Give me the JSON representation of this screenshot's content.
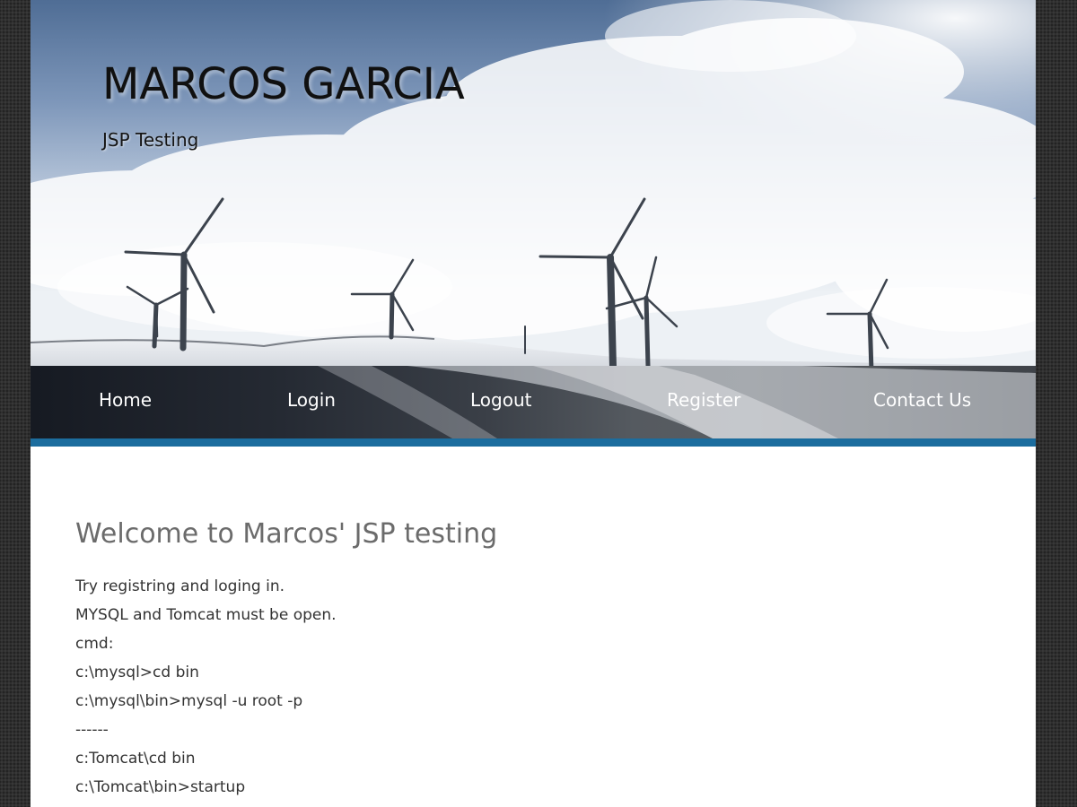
{
  "header": {
    "title": "MARCOS GARCIA",
    "tagline": "JSP Testing",
    "banner_image": "wind-turbines-on-snowy-hill"
  },
  "nav": {
    "items": [
      {
        "label": "Home"
      },
      {
        "label": "Login"
      },
      {
        "label": "Logout"
      },
      {
        "label": "Register"
      },
      {
        "label": "Contact Us"
      }
    ]
  },
  "main": {
    "heading": "Welcome to Marcos' JSP testing",
    "lines": [
      "Try registring and loging in.",
      "MYSQL and Tomcat must be open.",
      "cmd:",
      "c:\\mysql>cd bin",
      "c:\\mysql\\bin>mysql -u root -p",
      "------",
      "c:Tomcat\\cd bin",
      "c:\\Tomcat\\bin>startup"
    ]
  },
  "colors": {
    "accent_bar": "#1c6d9e",
    "page_background": "#2f2f2f",
    "content_background": "#ffffff",
    "heading_text": "#6b6b6b",
    "body_text": "#333333",
    "nav_text": "#ffffff"
  }
}
